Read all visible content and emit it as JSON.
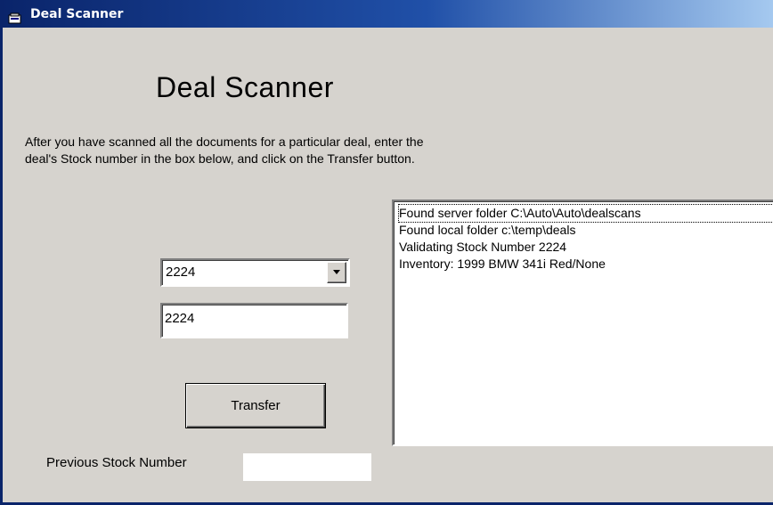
{
  "window": {
    "title": "Deal Scanner"
  },
  "form": {
    "heading": "Deal Scanner",
    "instructions_line1": "After you have scanned all the documents for a particular deal, enter the",
    "instructions_line2": "deal's Stock number in the box below, and click on the Transfer button.",
    "stock_combo_value": "2224",
    "stock_text_value": "2224",
    "transfer_label": "Transfer",
    "previous_label": "Previous Stock Number",
    "previous_value": ""
  },
  "log": {
    "items": [
      "Found server folder C:\\Auto\\Auto\\dealscans",
      "Found local folder c:\\temp\\deals",
      "Validating Stock Number 2224",
      "Inventory: 1999 BMW 341i Red/None"
    ]
  },
  "icons": {
    "app": "scanner-icon",
    "dropdown": "chevron-down-icon"
  }
}
